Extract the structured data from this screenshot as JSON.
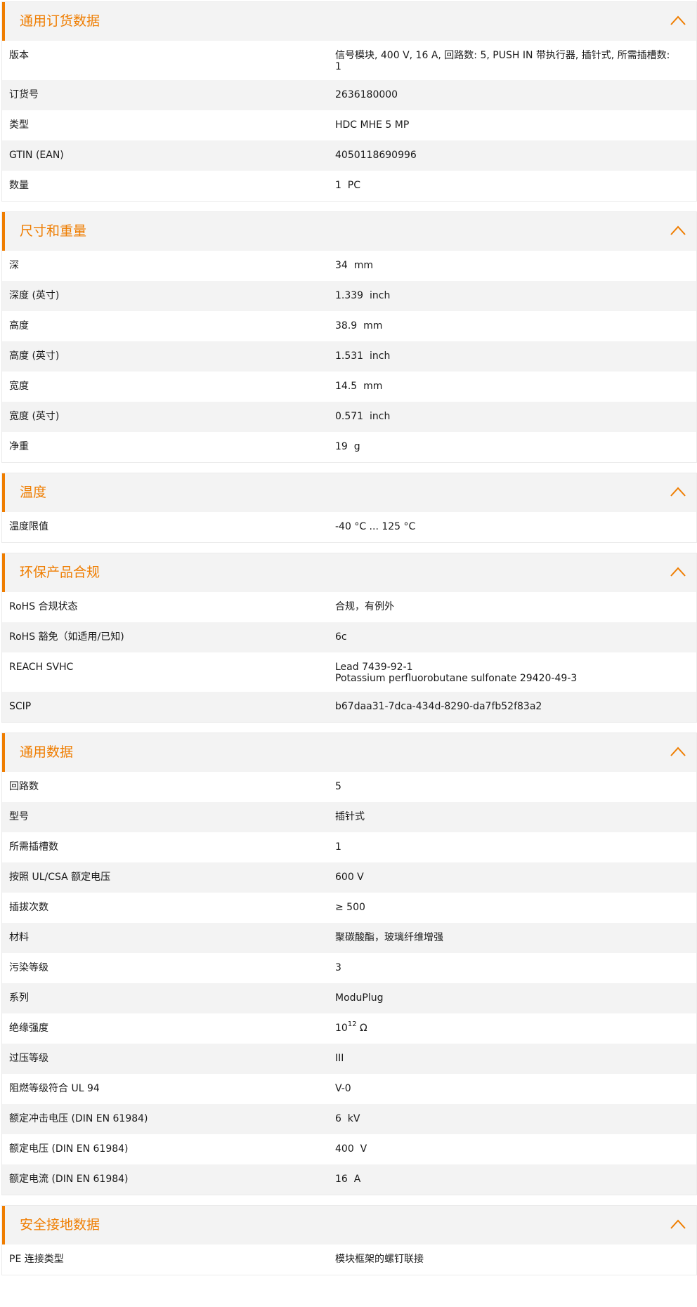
{
  "accent_color": "#ef7d00",
  "sections": [
    {
      "title": "通用订货数据",
      "icon": "chevron-up-icon",
      "rows": [
        {
          "label": "版本",
          "value": "信号模块, 400 V, 16 A, 回路数: 5, PUSH IN 带执行器, 插针式, 所需插槽数:\n1"
        },
        {
          "label": "订货号",
          "value": "2636180000"
        },
        {
          "label": "类型",
          "value": "HDC MHE 5 MP"
        },
        {
          "label": "GTIN (EAN)",
          "value": "4050118690996"
        },
        {
          "label": "数量",
          "value": "1  PC"
        }
      ]
    },
    {
      "title": "尺寸和重量",
      "icon": "chevron-up-icon",
      "rows": [
        {
          "label": "深",
          "value": "34  mm"
        },
        {
          "label": "深度 (英寸)",
          "value": "1.339  inch"
        },
        {
          "label": "高度",
          "value": "38.9  mm"
        },
        {
          "label": "高度 (英寸)",
          "value": "1.531  inch"
        },
        {
          "label": "宽度",
          "value": "14.5  mm"
        },
        {
          "label": "宽度 (英寸)",
          "value": "0.571  inch"
        },
        {
          "label": "净重",
          "value": "19  g"
        }
      ]
    },
    {
      "title": "温度",
      "icon": "chevron-up-icon",
      "rows": [
        {
          "label": "温度限值",
          "value": "-40 °C ... 125 °C"
        }
      ]
    },
    {
      "title": "环保产品合规",
      "icon": "chevron-up-icon",
      "rows": [
        {
          "label": "RoHS 合规状态",
          "value": "合规，有例外"
        },
        {
          "label": "RoHS 豁免（如适用/已知)",
          "value": "6c"
        },
        {
          "label": "REACH SVHC",
          "value": "Lead 7439-92-1\nPotassium perfluorobutane sulfonate 29420-49-3"
        },
        {
          "label": "SCIP",
          "value": "b67daa31-7dca-434d-8290-da7fb52f83a2"
        }
      ]
    },
    {
      "title": "通用数据",
      "icon": "chevron-up-icon",
      "rows": [
        {
          "label": "回路数",
          "value": "5"
        },
        {
          "label": "型号",
          "value": "插针式"
        },
        {
          "label": "所需插槽数",
          "value": "1"
        },
        {
          "label": "按照 UL/CSA 额定电压",
          "value": "600 V"
        },
        {
          "label": "插拔次数",
          "value": "≥ 500"
        },
        {
          "label": "材料",
          "value": "聚碳酸酯，玻璃纤维增强"
        },
        {
          "label": "污染等级",
          "value": "3"
        },
        {
          "label": "系列",
          "value": "ModuPlug"
        },
        {
          "label": "绝缘强度",
          "value": "10",
          "sup": "12",
          "suffix": " Ω"
        },
        {
          "label": "过压等级",
          "value": "III"
        },
        {
          "label": "阻燃等级符合 UL 94",
          "value": "V-0"
        },
        {
          "label": "额定冲击电压 (DIN EN 61984)",
          "value": "6  kV"
        },
        {
          "label": "额定电压 (DIN EN 61984)",
          "value": "400  V"
        },
        {
          "label": "额定电流 (DIN EN 61984)",
          "value": "16  A"
        }
      ]
    },
    {
      "title": "安全接地数据",
      "icon": "chevron-up-icon",
      "rows": [
        {
          "label": "PE 连接类型",
          "value": "模块框架的螺钉联接"
        }
      ]
    }
  ]
}
